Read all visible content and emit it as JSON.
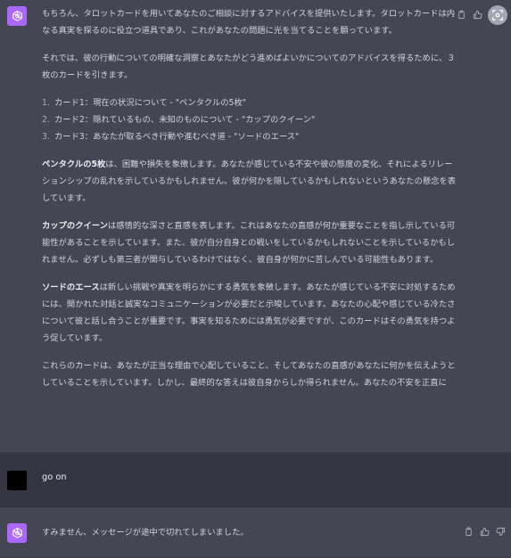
{
  "messages": {
    "assistant1": {
      "intro": "もちろん、タロットカードを用いてあなたのご相談に対するアドバイスを提供いたします。タロットカードは内なる真実を探るのに役立つ道具であり、これがあなたの問題に光を当てることを願っています。",
      "draw_intro": "それでは、彼の行動についての明確な洞察とあなたがどう進めばよいかについてのアドバイスを得るために、３枚のカードを引きます。",
      "cards": [
        {
          "num": "1.",
          "text": "カード1：現在の状況について - \"ペンタクルの5枚\""
        },
        {
          "num": "2.",
          "text": "カード2：隠れているもの、未知のものについて - \"カップのクイーン\""
        },
        {
          "num": "3.",
          "text": "カード3：あなたが取るべき行動や進むべき道 - \"ソードのエース\""
        }
      ],
      "para1_bold": "ペンタクルの5枚",
      "para1_rest": "は、困難や損失を象徴します。あなたが感じている不安や彼の態度の変化、それによるリレーションシップの乱れを示しているかもしれません。彼が何かを隠しているかもしれないというあなたの懸念を表しています。",
      "para2_bold": "カップのクイーン",
      "para2_rest": "は感情的な深さと直感を表します。これはあなたの直感が何か重要なことを指し示している可能性があることを示しています。また、彼が自分自身との戦いをしているかもしれないことを示しているかもしれません。必ずしも第三者が関与しているわけではなく、彼自身が何かに苦しんでいる可能性もあります。",
      "para3_bold": "ソードのエース",
      "para3_rest": "は新しい挑戦や真実を明らかにする勇気を象徴します。あなたが感じている不安に対処するためには、開かれた対話と誠実なコミュニケーションが必要だと示唆しています。あなたの心配や感じている冷たさについて彼と話し合うことが重要です。事実を知るためには勇気が必要ですが、このカードはその勇気を持つよう促しています。",
      "para4": "これらのカードは、あなたが正当な理由で心配していること、そしてあなたの直感があなたに何かを伝えようとしていることを示しています。しかし、最終的な答えは彼自身からしか得られません。あなたの不安を正直に"
    },
    "user1": {
      "text": "go on"
    },
    "assistant2": {
      "text": "すみません、メッセージが途中で切れてしまいました。"
    }
  },
  "icons": {
    "avatar_gpt": "openai-logo-icon",
    "copy": "clipboard-icon",
    "thumbs_up": "thumbs-up-icon",
    "thumbs_down": "thumbs-down-icon",
    "scroll": "lens-icon"
  },
  "colors": {
    "assistant_bg": "#444654",
    "user_bg": "#343541",
    "gpt_avatar": "#ab68ff",
    "text": "#d1d5db"
  }
}
